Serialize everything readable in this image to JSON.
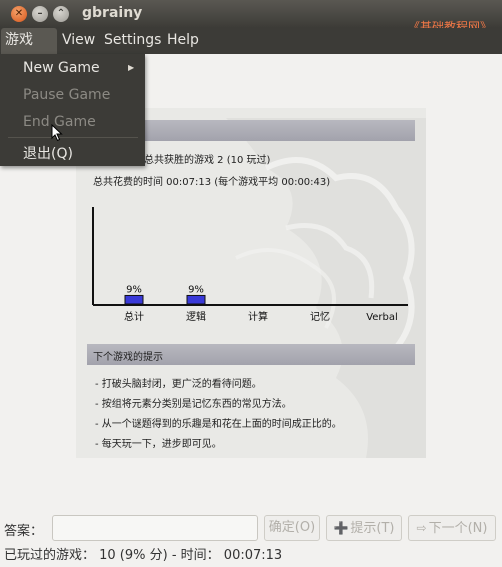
{
  "window": {
    "title": "gbrainy",
    "watermark": "《基础教程网》"
  },
  "menubar": {
    "game": "游戏(G)",
    "view": "View",
    "settings": "Settings",
    "help": "Help"
  },
  "game_menu": {
    "new_game": "New Game",
    "pause_game": "Pause Game",
    "end_game": "End Game",
    "quit": "退出(Q)"
  },
  "results": {
    "games_won": "总共获胜的游戏 2 (10 玩过)",
    "time_spent": "总共花费的时间 00:07:13 (每个游戏平均 00:00:43)"
  },
  "chart_data": {
    "type": "bar",
    "categories": [
      "总计",
      "逻辑",
      "计算",
      "记忆",
      "Verbal"
    ],
    "values": [
      9,
      9,
      0,
      0,
      0
    ],
    "data_labels": [
      "9%",
      "9%",
      "",
      "",
      ""
    ],
    "ylim": [
      0,
      100
    ],
    "bar_color": "#3a3ad8"
  },
  "tips": {
    "header": "下个游戏的提示",
    "items": [
      "- 打破头脑封闭，更广泛的看待问题。",
      "- 按组将元素分类别是记忆东西的常见方法。",
      "- 从一个谜题得到的乐趣是和花在上面的时间成正比的。",
      "- 每天玩一下，进步即可见。"
    ]
  },
  "answer": {
    "label": "答案：",
    "value": "",
    "ok": "确定(O)",
    "tip": "提示(T)",
    "next": "下一个(N)"
  },
  "status": {
    "text": "已玩过的游戏： 10 (9% 分) - 时间： 00:07:13"
  },
  "colors": {
    "titlebar": "#3c3b37",
    "accent": "#f07746",
    "header_band": "#a8a8b2"
  }
}
